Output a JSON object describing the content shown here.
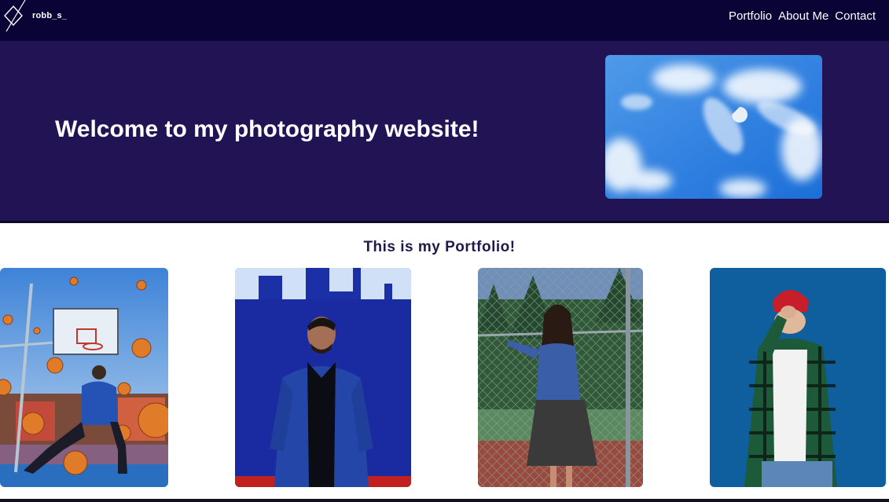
{
  "nav": {
    "brand": "robb_s_",
    "links": [
      {
        "label": "Portfolio"
      },
      {
        "label": "About Me"
      },
      {
        "label": "Contact"
      }
    ]
  },
  "hero": {
    "title": "Welcome to my photography website!"
  },
  "portfolio": {
    "heading": "This is my Portfolio!"
  },
  "colors": {
    "navbar": "#0a0436",
    "hero": "#221354",
    "heading": "#23194a"
  },
  "icons": {
    "logo": "diamond-logo-icon"
  }
}
